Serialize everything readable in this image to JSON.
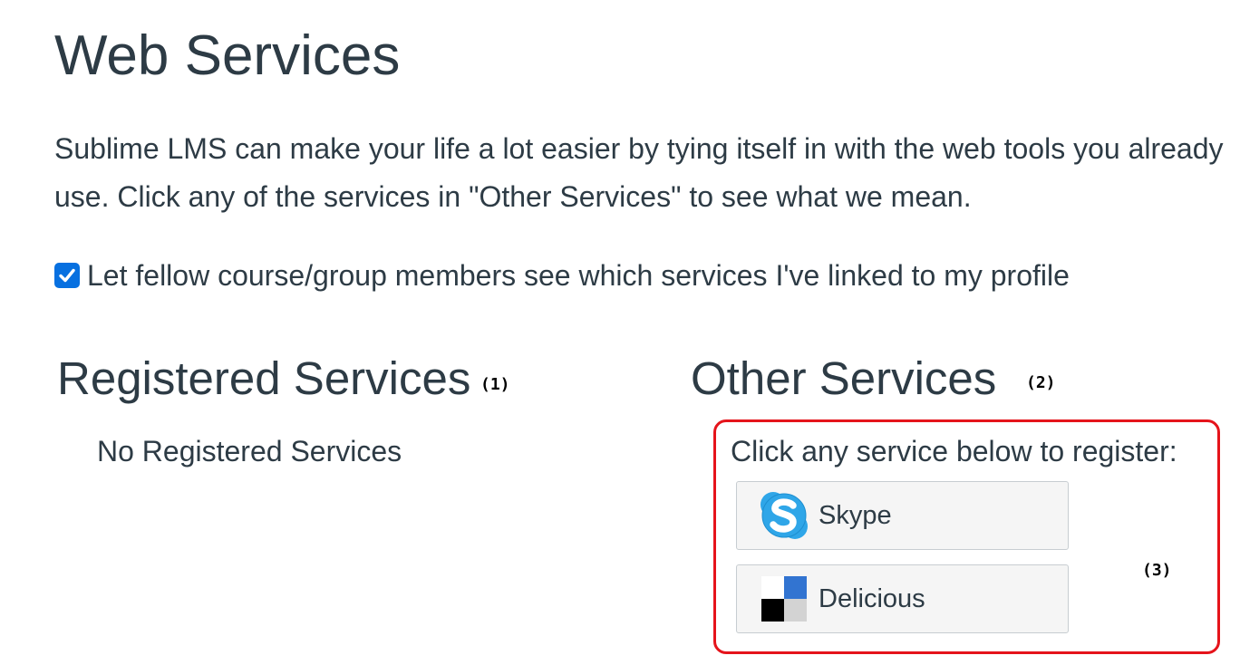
{
  "page": {
    "title": "Web Services",
    "intro": "Sublime LMS can make your life a lot easier by tying itself in with the web tools you already use. Click any of the services in \"Other Services\" to see what we mean.",
    "share_checkbox": {
      "label": "Let fellow course/group members see which services I've linked to my profile",
      "checked": true
    }
  },
  "registered": {
    "heading": "Registered Services",
    "callout": "(1)",
    "empty_text": "No Registered Services"
  },
  "other": {
    "heading": "Other Services",
    "callout": "(2)",
    "prompt": "Click any service below to register:",
    "list_callout": "(3)",
    "services": [
      {
        "label": "Skype",
        "icon": "skype-icon"
      },
      {
        "label": "Delicious",
        "icon": "delicious-icon"
      }
    ]
  },
  "colors": {
    "text": "#2d3b45",
    "checkbox": "#0770e0",
    "highlight_border": "#e5141b",
    "skype_blue": "#2fa6e8",
    "delicious_blue": "#3274d1"
  }
}
